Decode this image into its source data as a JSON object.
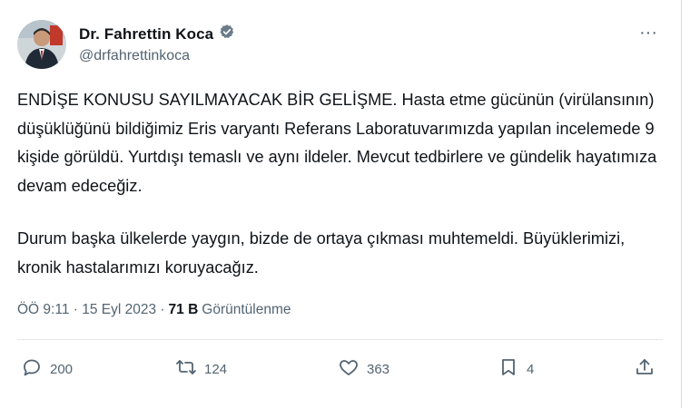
{
  "tweet": {
    "author": {
      "name": "Dr. Fahrettin Koca",
      "handle": "@drfahrettinkoca",
      "verified": true,
      "avatar_icon": "avatar"
    },
    "more_label": "···",
    "paragraphs": [
      "ENDİŞE KONUSU SAYILMAYACAK BİR GELİŞME. Hasta etme gücünün (virülansının) düşüklüğünü bildiğimiz Eris varyantı Referans Laboratuvarımızda yapılan incelemede 9 kişide görüldü. Yurtdışı temaslı ve aynı ildeler. Mevcut tedbirlere ve gündelik hayatımıza devam edeceğiz.",
      "Durum başka ülkelerde yaygın, bizde de ortaya çıkması muhtemeldi. Büyüklerimizi, kronik hastalarımızı koruyacağız."
    ],
    "meta": {
      "time_date": "ÖÖ 9:11 · 15 Eyl 2023 ·",
      "views_count": "71 B",
      "views_label": "Görüntülenme"
    },
    "actions": {
      "replies": "200",
      "retweets": "124",
      "likes": "363",
      "bookmarks": "4"
    }
  },
  "colors": {
    "text": "#0f1419",
    "muted": "#536471",
    "verified_badge": "#6a7b89"
  }
}
